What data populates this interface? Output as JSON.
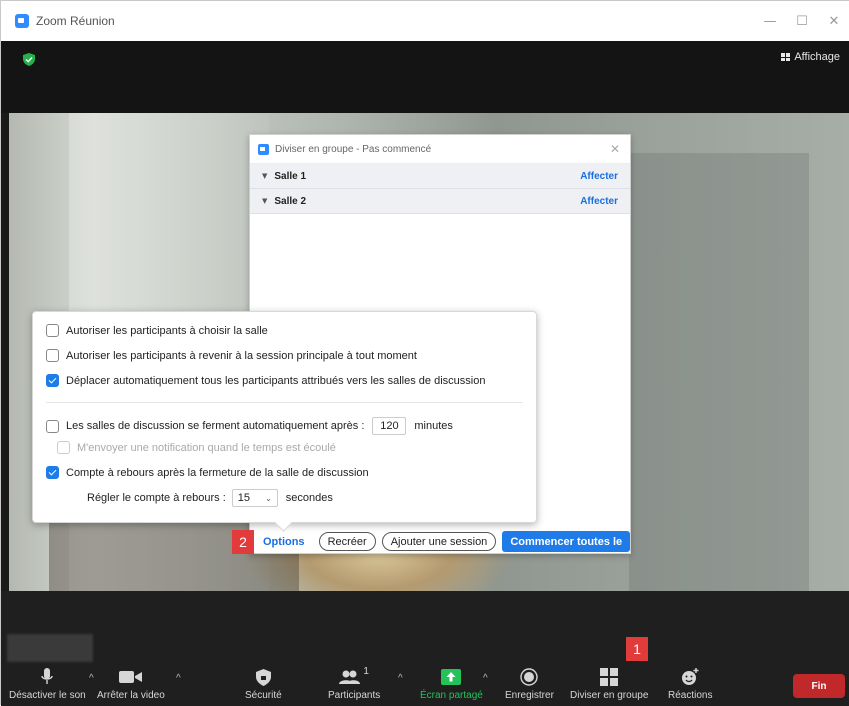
{
  "window": {
    "title": "Zoom Réunion",
    "controls": [
      "—",
      "☐",
      "✕"
    ]
  },
  "header": {
    "view_label": "Affichage"
  },
  "breakout_dialog": {
    "title": "Diviser en groupe - Pas commencé",
    "rooms": [
      {
        "name": "Salle 1",
        "action": "Affecter"
      },
      {
        "name": "Salle 2",
        "action": "Affecter"
      }
    ]
  },
  "options": {
    "allow_choose": {
      "label": "Autoriser les participants à choisir la salle",
      "checked": false
    },
    "allow_return": {
      "label": "Autoriser les participants à revenir à la session principale à tout moment",
      "checked": false
    },
    "auto_move": {
      "label": "Déplacer automatiquement tous les participants attribués vers les salles de discussion",
      "checked": true
    },
    "auto_close": {
      "label": "Les salles de discussion se ferment automatiquement après :",
      "checked": false,
      "value": "120",
      "unit": "minutes"
    },
    "notify": {
      "label": "M'envoyer une notification quand le temps est écoulé",
      "checked": false,
      "disabled": true
    },
    "countdown": {
      "label": "Compte à rebours après la fermeture de la salle de discussion",
      "checked": true
    },
    "countdown_setting": {
      "label": "Régler le compte à rebours :",
      "value": "15",
      "unit": "secondes"
    }
  },
  "footer": {
    "options": "Options",
    "recreate": "Recréer",
    "add_session": "Ajouter une session",
    "start_all": "Commencer toutes le"
  },
  "badges": {
    "one": "1",
    "two": "2"
  },
  "toolbar": {
    "mute": "Désactiver le son",
    "stop_video": "Arrêter la video",
    "security": "Sécurité",
    "participants": "Participants",
    "participants_count": "1",
    "share": "Écran partagé",
    "record": "Enregistrer",
    "breakout": "Diviser en groupe",
    "reactions": "Réactions",
    "end": "Fin"
  },
  "colors": {
    "accent": "#1e7be8",
    "share_green": "#23c35a",
    "end_red": "#c0282a",
    "badge_red": "#e23b3b"
  }
}
